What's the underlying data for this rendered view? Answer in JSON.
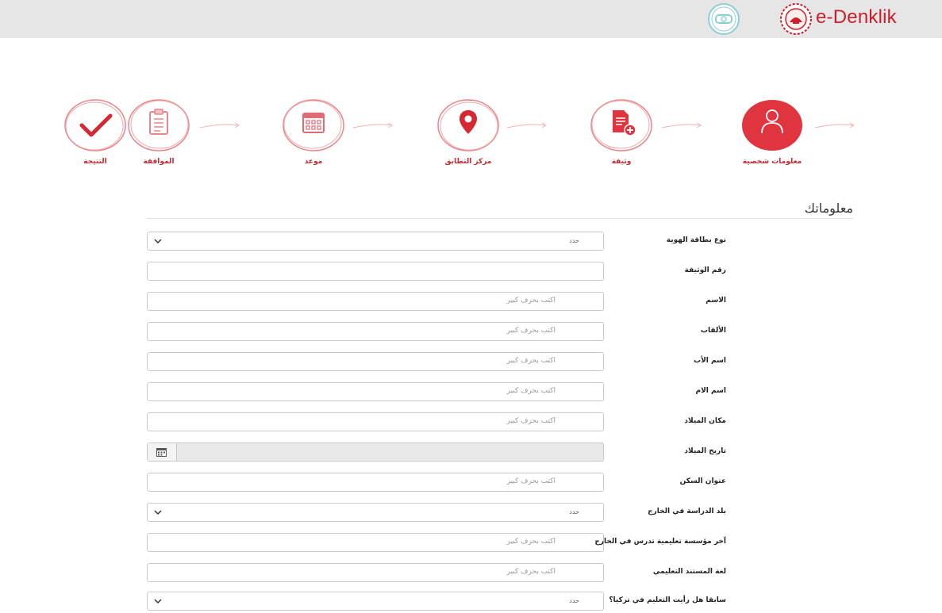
{
  "header": {
    "brand": "e-Denklik"
  },
  "steps": [
    {
      "label": "التتيجة",
      "icon": "checkmark-icon"
    },
    {
      "label": "الموافقة",
      "icon": "clipboard-icon"
    },
    {
      "label": "موعد",
      "icon": "calendar-icon"
    },
    {
      "label": "مركز التطابق",
      "icon": "location-pin-icon"
    },
    {
      "label": "وثيقة",
      "icon": "document-add-icon"
    },
    {
      "label": "معلومات شخصية",
      "icon": "user-icon",
      "active": true
    }
  ],
  "section": {
    "title": "معلوماتك"
  },
  "form": {
    "id_type": {
      "label": "نوع بطاقة الهوية",
      "value": "حدد"
    },
    "doc_number": {
      "label": "رقم الوثيقة",
      "placeholder": ""
    },
    "name": {
      "label": "الاسم",
      "placeholder": "اكتب بحرف كبير"
    },
    "surname": {
      "label": "الألقاب",
      "placeholder": "اكتب بحرف كبير"
    },
    "father_name": {
      "label": "اسم الأب",
      "placeholder": "اكتب بحرف كبير"
    },
    "mother_name": {
      "label": "اسم الام",
      "placeholder": "اكتب بحرف كبير"
    },
    "birth_place": {
      "label": "مكان الميلاد",
      "placeholder": "اكتب بحرف كبير"
    },
    "birth_date": {
      "label": "تاريخ الميلاد"
    },
    "address": {
      "label": "عنوان السكن",
      "placeholder": "اكتب بحرف كبير"
    },
    "study_country": {
      "label": "بلد الدراسة في الخارج",
      "value": "حدد"
    },
    "last_institution": {
      "label": "آخر مؤسسة تعليمية تدرس في الخارج",
      "placeholder": "اكتب بحرف كبير"
    },
    "doc_language": {
      "label": "لغة المستند التعليمي",
      "placeholder": "اكتب بحرف كبير"
    },
    "prior_turkey": {
      "label": "سابقا هل رأيت التعليم في تركيا؟",
      "value": "حدد"
    }
  },
  "colors": {
    "accent": "#e0343f",
    "brand": "#cc1f2a",
    "step_stroke": "#e8868b"
  }
}
